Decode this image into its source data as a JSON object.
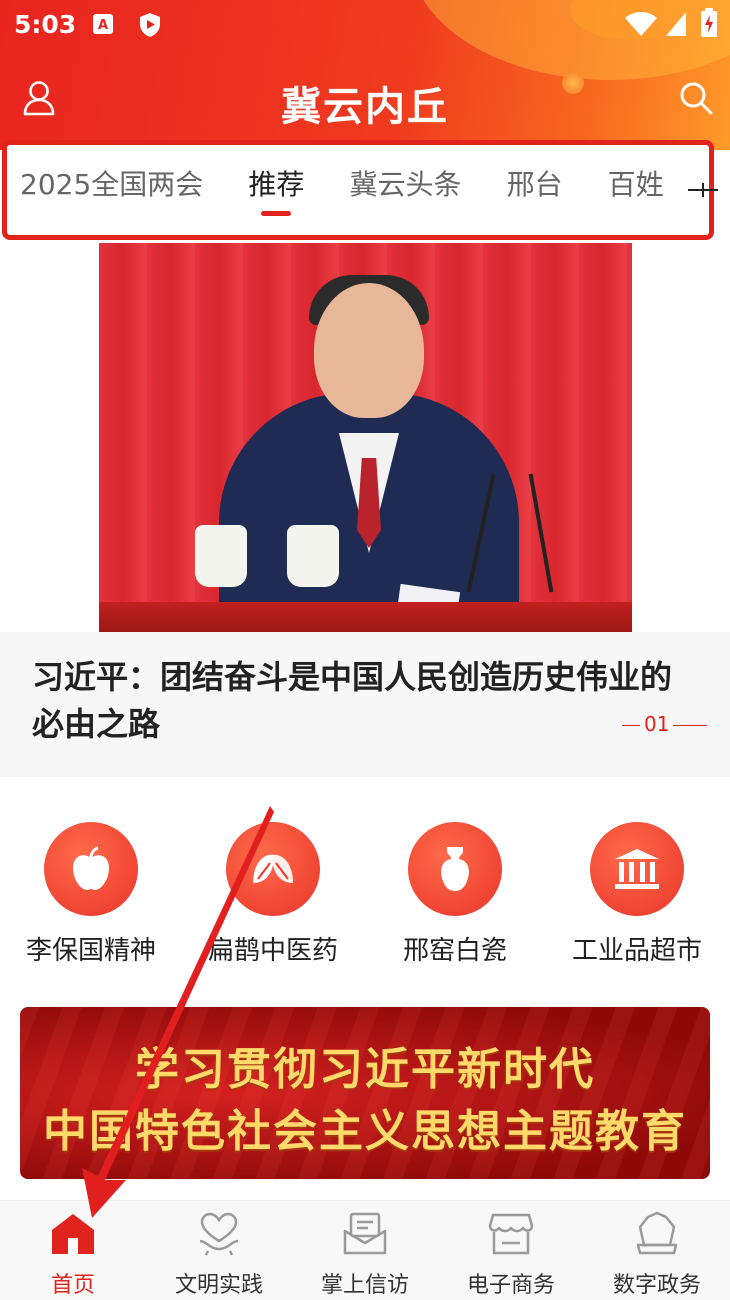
{
  "status_bar": {
    "time": "5:03"
  },
  "header": {
    "title": "冀云内丘"
  },
  "tabs": [
    {
      "label": "2025全国两会",
      "active": false
    },
    {
      "label": "推荐",
      "active": true
    },
    {
      "label": "冀云头条",
      "active": false
    },
    {
      "label": "邢台",
      "active": false
    },
    {
      "label": "百姓",
      "active": false
    }
  ],
  "hero": {
    "caption": "习近平：团结奋斗是中国人民创造历史伟业的必由之路",
    "page_indicator": "01"
  },
  "shortcuts": [
    {
      "label": "李保国精神",
      "icon": "apple-icon"
    },
    {
      "label": "扁鹊中医药",
      "icon": "leaf-icon"
    },
    {
      "label": "邢窑白瓷",
      "icon": "vase-icon"
    },
    {
      "label": "工业品超市",
      "icon": "building-icon"
    }
  ],
  "banner": {
    "line1": "学习贯彻习近平新时代",
    "line2": "中国特色社会主义思想主题教育"
  },
  "bottom_nav": [
    {
      "label": "首页",
      "active": true,
      "icon": "home-icon"
    },
    {
      "label": "文明实践",
      "active": false,
      "icon": "heart-hand-icon"
    },
    {
      "label": "掌上信访",
      "active": false,
      "icon": "mail-icon"
    },
    {
      "label": "电子商务",
      "active": false,
      "icon": "store-icon"
    },
    {
      "label": "数字政务",
      "active": false,
      "icon": "gov-icon"
    }
  ],
  "colors": {
    "accent": "#e1231e",
    "header_start": "#e8241f",
    "header_end": "#ff9a2a",
    "banner_text": "#ffd96a"
  }
}
